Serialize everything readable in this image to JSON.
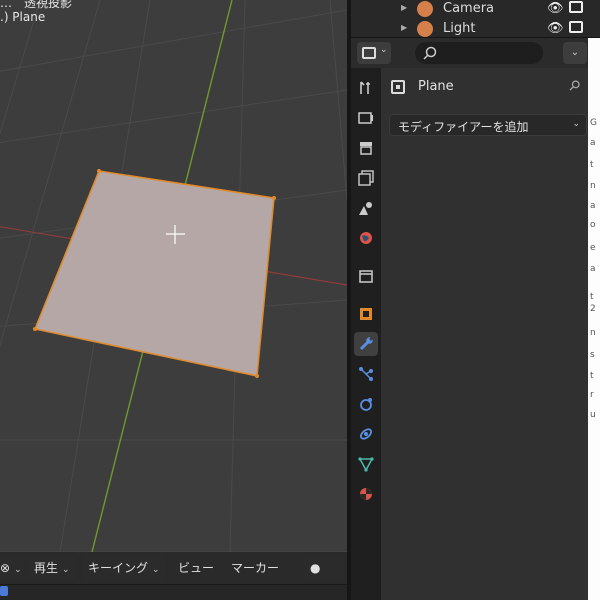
{
  "viewport": {
    "header_line1": "…　透視投影",
    "header_line2": ".) Plane"
  },
  "outliner": {
    "items": [
      {
        "label": "Camera",
        "icon": "camera-object-icon"
      },
      {
        "label": "Light",
        "icon": "light-object-icon"
      }
    ]
  },
  "properties": {
    "object_name": "Plane",
    "add_modifier_label": "モディファイアーを追加",
    "active_tab": "modifiers",
    "tabs": [
      "tool",
      "render",
      "output",
      "view-layer",
      "scene",
      "world",
      "collection",
      "object",
      "modifiers",
      "particles",
      "physics",
      "constraints",
      "data",
      "material"
    ]
  },
  "timeline": {
    "menu_playback": "再生",
    "menu_keying": "キーイング",
    "menu_view": "ビュー",
    "menu_marker": "マーカー"
  },
  "colors": {
    "selection_orange": "#e08a2a",
    "x_axis": "#9a3a3a",
    "y_axis": "#6d9a2f",
    "plane_fill": "#b4a7a5",
    "accent_blue": "#4b7bd6"
  },
  "cut_strip": [
    "G",
    "a",
    "t",
    "n",
    "a",
    "o",
    "e",
    "a",
    "t",
    "2",
    "n",
    "s",
    "t",
    "r",
    "u"
  ]
}
